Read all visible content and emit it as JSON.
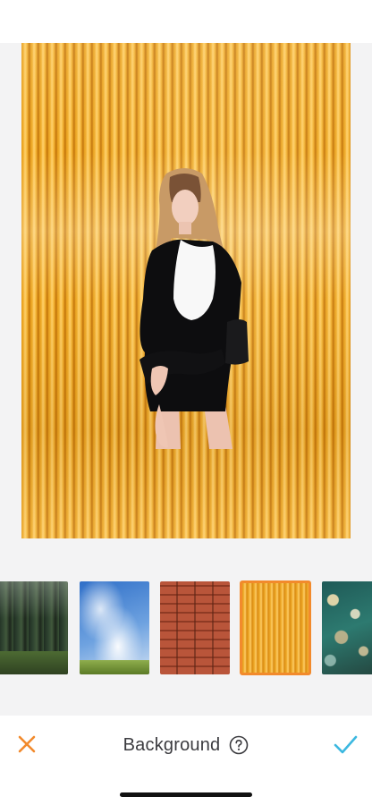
{
  "toolbar": {
    "title": "Background",
    "cancel_icon": "close-icon",
    "help_icon": "question-circle-icon",
    "confirm_icon": "checkmark-icon"
  },
  "colors": {
    "accent_orange": "#f28a2c",
    "accent_blue": "#3cb8e0",
    "text": "#3b3b3f",
    "canvas_gold": "#f0ae2c"
  },
  "backgrounds": [
    {
      "name": "forest",
      "selected": false
    },
    {
      "name": "sky",
      "selected": false
    },
    {
      "name": "brick",
      "selected": false
    },
    {
      "name": "gold",
      "selected": true
    },
    {
      "name": "bokeh",
      "selected": false
    }
  ]
}
